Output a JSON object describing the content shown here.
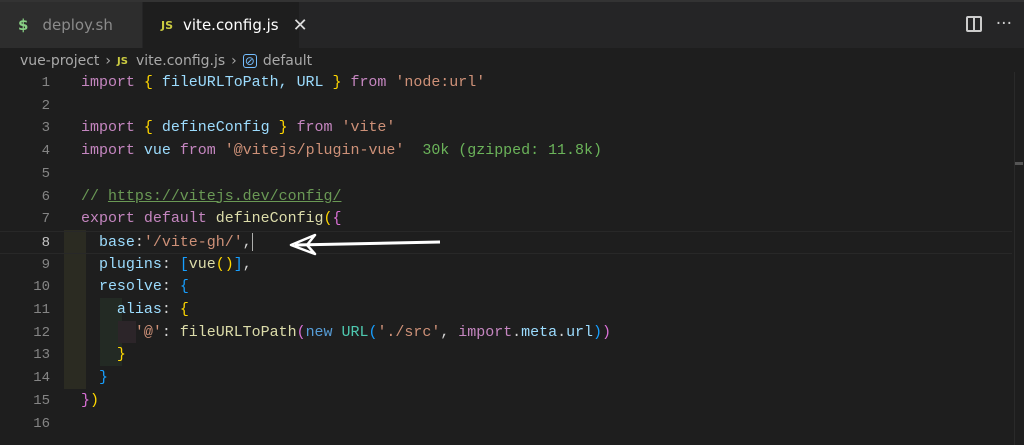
{
  "tabs": [
    {
      "label": "deploy.sh",
      "icon": "$",
      "active": false
    },
    {
      "label": "vite.config.js",
      "icon": "JS",
      "active": true
    }
  ],
  "breadcrumb": [
    "vue-project",
    "vite.config.js",
    "default"
  ],
  "js_badge": "JS",
  "dollar": "$",
  "more": "···",
  "colors": {
    "keyword": "#c586c0",
    "ident": "#9cdcfe",
    "string": "#ce9178",
    "comment": "#6a9955",
    "func": "#dcdcaa",
    "blue": "#569cd6",
    "cls": "#4ec9b0",
    "gold": "#ffd700",
    "orchid": "#da70d6",
    "sky": "#179fff",
    "hint": "#6bb35a",
    "plain": "#d4d4d4"
  },
  "lines": [
    [
      [
        "import ",
        "keyword"
      ],
      [
        "{ ",
        "gold"
      ],
      [
        "fileURLToPath, URL ",
        "ident"
      ],
      [
        "} ",
        "gold"
      ],
      [
        "from ",
        "keyword"
      ],
      [
        "'node:url'",
        "string"
      ]
    ],
    [],
    [
      [
        "import ",
        "keyword"
      ],
      [
        "{ ",
        "gold"
      ],
      [
        "defineConfig ",
        "ident"
      ],
      [
        "} ",
        "gold"
      ],
      [
        "from ",
        "keyword"
      ],
      [
        "'vite'",
        "string"
      ]
    ],
    [
      [
        "import ",
        "keyword"
      ],
      [
        "vue ",
        "ident"
      ],
      [
        "from ",
        "keyword"
      ],
      [
        "'@vitejs/plugin-vue'",
        "string"
      ],
      [
        "  30k (gzipped: 11.8k)",
        "hint"
      ]
    ],
    [],
    [
      [
        "// ",
        "comment"
      ],
      [
        "https://vitejs.dev/config/",
        "commentlink"
      ]
    ],
    [
      [
        "export default ",
        "keyword"
      ],
      [
        "defineConfig",
        "func"
      ],
      [
        "(",
        "gold"
      ],
      [
        "{",
        "orchid"
      ]
    ],
    [
      [
        "  base",
        "ident"
      ],
      [
        ":",
        "plain"
      ],
      [
        "'/vite-gh/'",
        "string"
      ],
      [
        ",",
        "plain"
      ]
    ],
    [
      [
        "  plugins",
        "ident"
      ],
      [
        ": ",
        "plain"
      ],
      [
        "[",
        "sky"
      ],
      [
        "vue",
        "func"
      ],
      [
        "()",
        "gold"
      ],
      [
        "]",
        "sky"
      ],
      [
        ",",
        "plain"
      ]
    ],
    [
      [
        "  resolve",
        "ident"
      ],
      [
        ": ",
        "plain"
      ],
      [
        "{",
        "sky"
      ]
    ],
    [
      [
        "    alias",
        "ident"
      ],
      [
        ": ",
        "plain"
      ],
      [
        "{",
        "gold"
      ]
    ],
    [
      [
        "      '@'",
        "string"
      ],
      [
        ": ",
        "plain"
      ],
      [
        "fileURLToPath",
        "func"
      ],
      [
        "(",
        "orchid"
      ],
      [
        "new ",
        "blue"
      ],
      [
        "URL",
        "cls"
      ],
      [
        "(",
        "sky"
      ],
      [
        "'./src'",
        "string"
      ],
      [
        ", ",
        "plain"
      ],
      [
        "import",
        "keyword"
      ],
      [
        ".",
        "plain"
      ],
      [
        "meta",
        "ident"
      ],
      [
        ".",
        "plain"
      ],
      [
        "url",
        "ident"
      ],
      [
        ")",
        "sky"
      ],
      [
        ")",
        "orchid"
      ]
    ],
    [
      [
        "    }",
        "gold"
      ]
    ],
    [
      [
        "  }",
        "sky"
      ]
    ],
    [
      [
        "}",
        "orchid"
      ],
      [
        ")",
        "gold"
      ]
    ],
    []
  ],
  "active_line": 8
}
